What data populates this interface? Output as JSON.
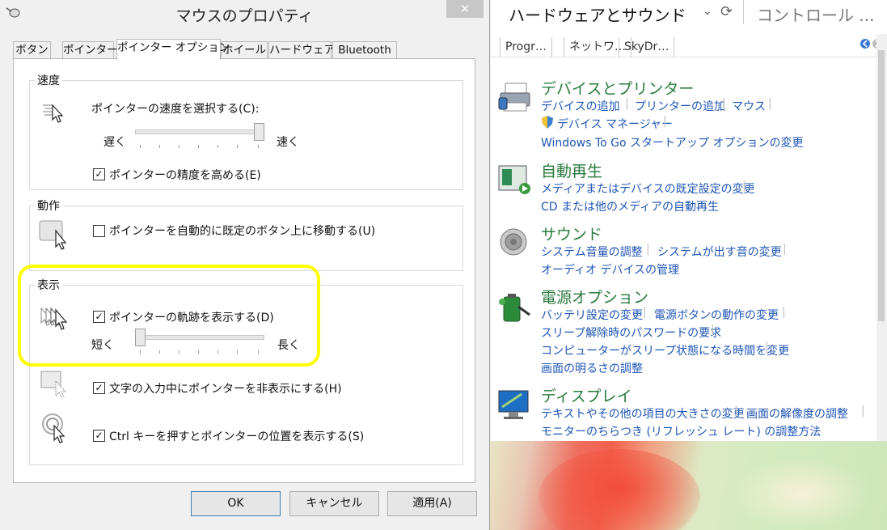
{
  "dialog": {
    "title": "マウスのプロパティ",
    "close_glyph": "✕",
    "tabs": [
      "ボタン",
      "ポインター",
      "ポインター オプション",
      "ホイール",
      "ハードウェア",
      "Bluetooth"
    ],
    "active_tab": "ポインター オプション",
    "motion": {
      "group_label": "速度",
      "speed_label": "ポインターの速度を選択する(C):",
      "slow_label": "遅く",
      "fast_label": "速く",
      "speed_value": 1.0,
      "precision_label": "ポインターの精度を高める(E)",
      "precision_checked": true
    },
    "snap": {
      "group_label": "動作",
      "snap_label": "ポインターを自動的に既定のボタン上に移動する(U)",
      "snap_checked": false
    },
    "visibility": {
      "group_label": "表示",
      "trails_label": "ポインターの軌跡を表示する(D)",
      "trails_checked": true,
      "short_label": "短く",
      "long_label": "長く",
      "trail_length_value": 0.0,
      "hide_label": "文字の入力中にポインターを非表示にする(H)",
      "hide_checked": true,
      "ctrl_label": "Ctrl キーを押すとポインターの位置を表示する(S)",
      "ctrl_checked": true
    },
    "buttons": {
      "ok": "OK",
      "cancel": "キャンセル",
      "apply": "適用(A)"
    },
    "check_glyph": "✓"
  },
  "control_panel": {
    "address": "ハードウェアとサウンド",
    "chevron": "⌄",
    "refresh_glyph": "⟳",
    "search_placeholder": "コントロール ...",
    "favorites": [
      "Progr…",
      "ネットワ…",
      "SkyDr…"
    ],
    "sections": [
      {
        "title": "デバイスとプリンター",
        "icon": "printer-icon",
        "links": [
          "デバイスの追加",
          "プリンターの追加",
          "マウス",
          "デバイス マネージャー",
          "Windows To Go スタートアップ オプションの変更"
        ]
      },
      {
        "title": "自動再生",
        "icon": "autoplay-icon",
        "links": [
          "メディアまたはデバイスの既定設定の変更",
          "CD または他のメディアの自動再生"
        ]
      },
      {
        "title": "サウンド",
        "icon": "speaker-icon",
        "links": [
          "システム音量の調整",
          "システムが出す音の変更",
          "オーディオ デバイスの管理"
        ]
      },
      {
        "title": "電源オプション",
        "icon": "battery-icon",
        "links": [
          "バッテリ設定の変更",
          "電源ボタンの動作の変更",
          "スリープ解除時のパスワードの要求",
          "コンピューターがスリープ状態になる時間を変更",
          "画面の明るさの調整"
        ]
      },
      {
        "title": "ディスプレイ",
        "icon": "display-icon",
        "links": [
          "テキストやその他の項目の大きさの変更",
          "画面の解像度の調整",
          "モニターのちらつき (リフレッシュ レート) の調整方法"
        ]
      }
    ]
  },
  "colors": {
    "highlight": "#ffff00",
    "link": "#1f55b5",
    "section_title": "#2a7a3f"
  }
}
